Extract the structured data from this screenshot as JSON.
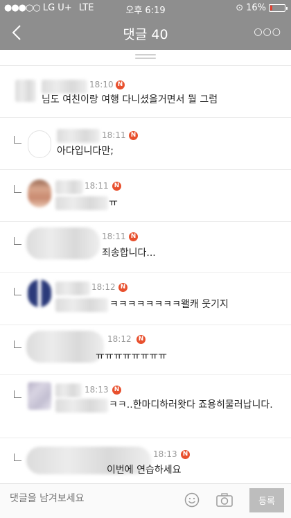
{
  "status_bar": {
    "carrier": "LG U+",
    "network": "LTE",
    "time": "오후 6:19",
    "battery": "16%",
    "battery_level": 0.16
  },
  "nav": {
    "title": "댓글 40"
  },
  "comments": [
    {
      "time": "18:10",
      "badge": "N",
      "text": "님도 여친이랑 여행 다니셨을거면서 뭘 그럼"
    },
    {
      "time": "18:11",
      "badge": "N",
      "text": "아다입니다만;"
    },
    {
      "time": "18:11",
      "badge": "N",
      "text": "ㅠ"
    },
    {
      "time": "18:11",
      "badge": "N",
      "text": "죄송합니다..."
    },
    {
      "time": "18:12",
      "badge": "N",
      "text": "ㅋㅋㅋㅋㅋㅋㅋㅋ왤캐 웃기지"
    },
    {
      "time": "18:12",
      "badge": "N",
      "text": "ㅠㅠㅠㅠㅠㅠㅠㅠ"
    },
    {
      "time": "18:13",
      "badge": "N",
      "text": "ㅋㅋ..한마디하러왓다 죠용히물러납니다."
    },
    {
      "time": "18:13",
      "badge": "N",
      "text": "이번에 연습하세요"
    }
  ],
  "composer": {
    "placeholder": "댓글을 남겨보세요",
    "submit_label": "등록"
  },
  "colors": {
    "bar": "#8e8e8e",
    "badge": "#e8502e",
    "battery_low": "#e53e2e"
  }
}
